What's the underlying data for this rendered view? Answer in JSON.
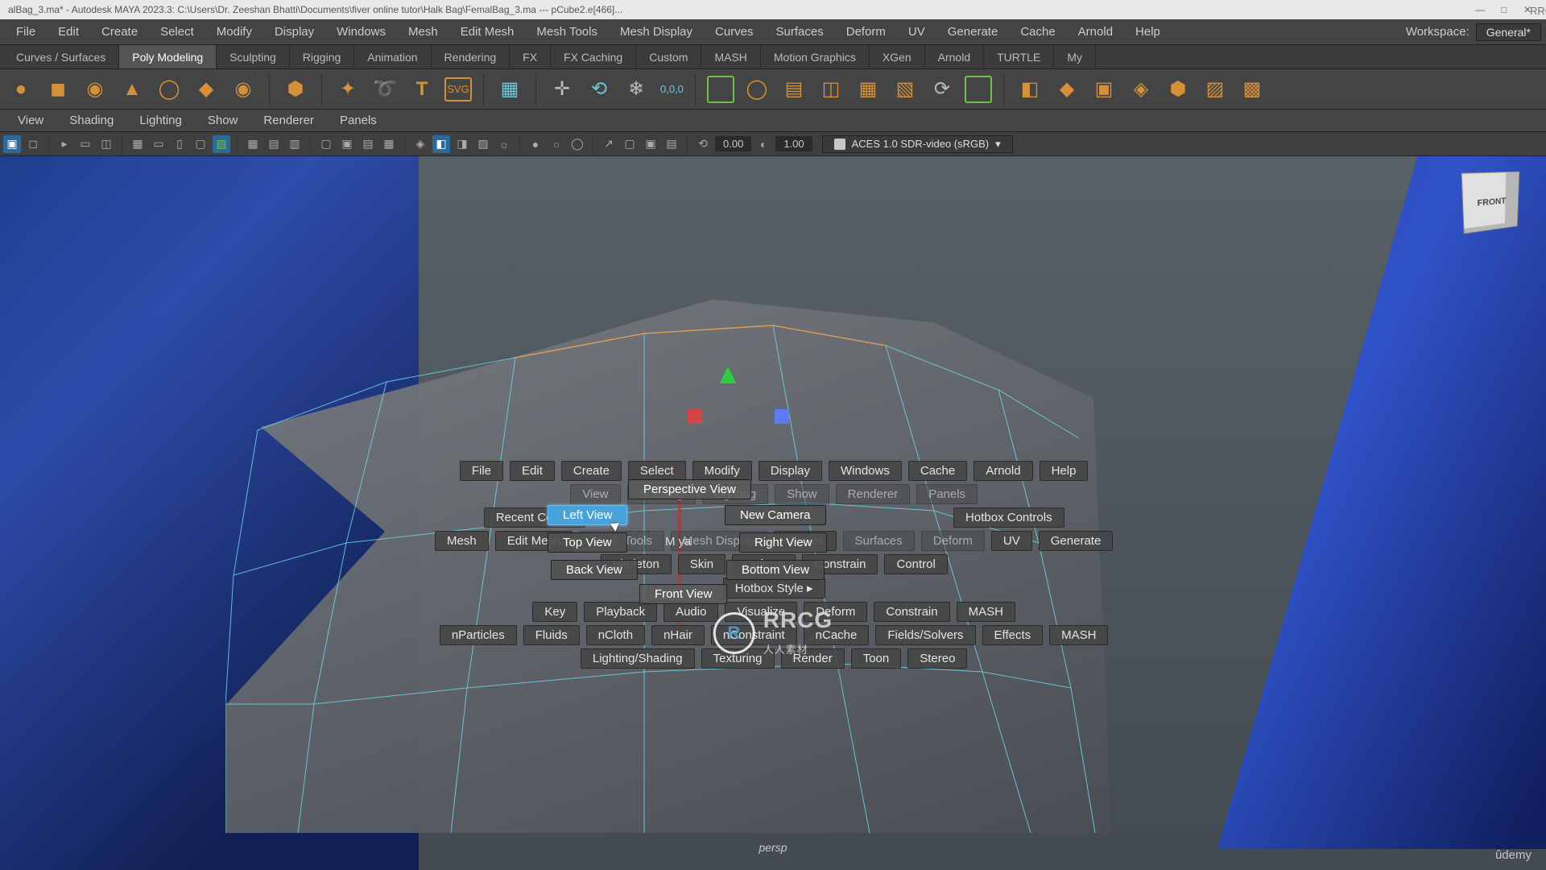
{
  "title_bar": {
    "left": "alBag_3.ma* - Autodesk MAYA 2023.3: C:\\Users\\Dr. Zeeshan Bhatti\\Documents\\fiver online tutor\\Halk Bag\\FemalBag_3.ma   ---   pCube2.e[466]...",
    "right_text": "RRCG.cn"
  },
  "main_menu": {
    "items": [
      "File",
      "Edit",
      "Create",
      "Select",
      "Modify",
      "Display",
      "Windows",
      "Mesh",
      "Edit Mesh",
      "Mesh Tools",
      "Mesh Display",
      "Curves",
      "Surfaces",
      "Deform",
      "UV",
      "Generate",
      "Cache",
      "Arnold",
      "Help"
    ],
    "workspace_label": "Workspace:",
    "workspace_value": "General*"
  },
  "shelf_tabs": {
    "items": [
      "Curves / Surfaces",
      "Poly Modeling",
      "Sculpting",
      "Rigging",
      "Animation",
      "Rendering",
      "FX",
      "FX Caching",
      "Custom",
      "MASH",
      "Motion Graphics",
      "XGen",
      "Arnold",
      "TURTLE",
      "My"
    ],
    "active": 1
  },
  "shelf_icons": {
    "coords": "0,0,0"
  },
  "panel_menu": {
    "items": [
      "View",
      "Shading",
      "Lighting",
      "Show",
      "Renderer",
      "Panels"
    ]
  },
  "panel_toolbar": {
    "num1": "0.00",
    "num2": "1.00",
    "color_space": "ACES 1.0 SDR-video (sRGB)"
  },
  "viewcube": {
    "face": "FRONT"
  },
  "viewport": {
    "persp_label": "persp",
    "watermark": "RRCG",
    "watermark_sub": "人人素材",
    "udemy": "ûdemy"
  },
  "hotbox": {
    "row1": [
      "File",
      "Edit",
      "Create",
      "Select",
      "Modify",
      "Display",
      "Windows",
      "Cache",
      "Arnold",
      "Help"
    ],
    "row2_faded": [
      "View",
      "Shading",
      "Lighting",
      "Show",
      "Renderer",
      "Panels"
    ],
    "row3": [
      "Recent Comm",
      "Maya",
      "Hotbox Controls"
    ],
    "row4": [
      "Mesh",
      "Edit Mesh",
      "Mesh Tools",
      "Mesh Display",
      "Curves",
      "Surfaces",
      "Deform",
      "UV",
      "Generate"
    ],
    "row5": [
      "Skeleton",
      "Skin",
      "Deform",
      "Constrain",
      "Control"
    ],
    "row6_style": "Hotbox Style   ▸",
    "row7": [
      "Key",
      "Playback",
      "Audio",
      "Visualize",
      "Deform",
      "Constrain",
      "MASH"
    ],
    "row8": [
      "nParticles",
      "Fluids",
      "nCloth",
      "nHair",
      "nConstraint",
      "nCache",
      "Fields/Solvers",
      "Effects",
      "MASH"
    ],
    "row9": [
      "Lighting/Shading",
      "Texturing",
      "Render",
      "Toon",
      "Stereo"
    ]
  },
  "radial": {
    "top": "Perspective View",
    "left_hl": "Left View",
    "top_right": "New Camera",
    "left2": "Top View",
    "right2": "Right View",
    "left3": "Back View",
    "right3": "Bottom View",
    "bottom": "Front View",
    "center_left": "M",
    "center_right": "ya"
  }
}
